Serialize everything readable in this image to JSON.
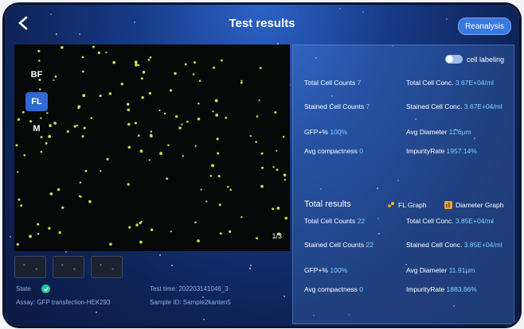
{
  "header": {
    "title": "Test results",
    "reanalysis_label": "Reanalysis"
  },
  "image_viewer": {
    "modes": [
      "BF",
      "FL",
      "M"
    ],
    "active_mode": "FL",
    "page_indicator": "1/3",
    "thumbnails": 3
  },
  "info": {
    "state_label": "State",
    "assay": "Assay: GFP transfection-HEK293",
    "test_time": "Test time: 20220314104​6_3",
    "sample_id": "Sample ID: Sample2kanten5"
  },
  "toggle": {
    "label": "cell labeling",
    "on": true
  },
  "current_results": [
    {
      "label": "Total Cell Counts",
      "value": "7"
    },
    {
      "label": "Total Cell Conc.",
      "value": "3.67E+04/ml"
    },
    {
      "label": "Stained Cell Counts",
      "value": "7"
    },
    {
      "label": "Stained Cell Conc.",
      "value": "3.67E+04/ml"
    },
    {
      "label": "GFP+%",
      "value": "100%"
    },
    {
      "label": "Avg Diameter",
      "value": "11.6μm"
    },
    {
      "label": "Avg compactness",
      "value": "0"
    },
    {
      "label": "ImpurityRate",
      "value": "1957.14%"
    }
  ],
  "total_section": {
    "title": "Total results",
    "fl_graph_label": "FL Graph",
    "diameter_graph_label": "Diameter Graph"
  },
  "total_results": [
    {
      "label": "Total Cell Counts",
      "value": "22"
    },
    {
      "label": "Total Cell Conc.",
      "value": "3.85E+04/ml"
    },
    {
      "label": "Stained Cell Counts",
      "value": "22"
    },
    {
      "label": "Stained Cell Conc.",
      "value": "3.85E+04/ml"
    },
    {
      "label": "GFP+%",
      "value": "100%"
    },
    {
      "label": "Avg Diameter",
      "value": "11.91μm"
    },
    {
      "label": "Avg compactness",
      "value": "0"
    },
    {
      "label": "ImpurityRate",
      "value": "1883.86%"
    }
  ],
  "colors": {
    "accent": "#2e6ad6",
    "value_text": "#7fd3ff",
    "cell_dot": "#b7e34a"
  }
}
